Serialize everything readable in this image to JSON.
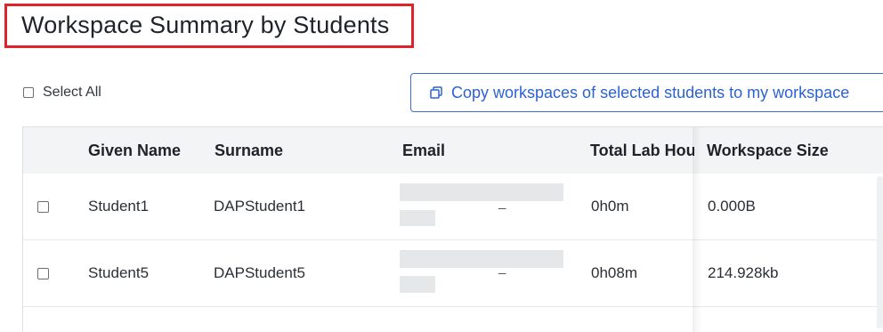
{
  "page": {
    "title": "Workspace Summary by Students"
  },
  "toolbar": {
    "select_all_label": "Select All",
    "copy_button_label": "Copy workspaces of selected students to my workspace"
  },
  "table": {
    "headers": {
      "given_name": "Given Name",
      "surname": "Surname",
      "email": "Email",
      "total_lab_hours": "Total Lab Hou",
      "workspace_size": "Workspace Size"
    },
    "rows": [
      {
        "given_name": "Student1",
        "surname": "DAPStudent1",
        "email_separator": "_",
        "total_lab_hours": "0h0m",
        "workspace_size": "0.000B"
      },
      {
        "given_name": "Student5",
        "surname": "DAPStudent5",
        "email_separator": "_",
        "total_lab_hours": "0h08m",
        "workspace_size": "214.928kb"
      }
    ]
  },
  "colors": {
    "title_highlight": "#e0232a",
    "accent": "#2d62d0",
    "header_bg": "#f3f4f5"
  },
  "icons": {
    "copy_button_icon": "copy-icon",
    "select_all_icon": "checkbox-icon"
  }
}
